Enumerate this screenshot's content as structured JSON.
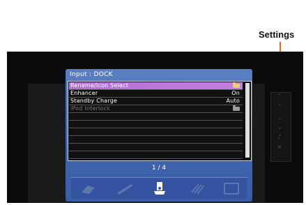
{
  "callout": {
    "label": "Settings"
  },
  "menu": {
    "title": "Input : DOCK",
    "rows": [
      {
        "label": "Rename/Icon Select",
        "value": ""
      },
      {
        "label": "Enhancer",
        "value": "On"
      },
      {
        "label": "Standby Charge",
        "value": "Auto"
      },
      {
        "label": "iPod Interlock",
        "value": ""
      }
    ],
    "page_indicator": "1 / 4"
  },
  "colors": {
    "selected_row": "#b56fd6",
    "menu_bg": "#4a6fb8",
    "callout": "#e06a1a"
  },
  "icons": [
    "disc-icon",
    "pen-icon",
    "ipod-dock-icon",
    "cable-icon",
    "box-icon"
  ]
}
